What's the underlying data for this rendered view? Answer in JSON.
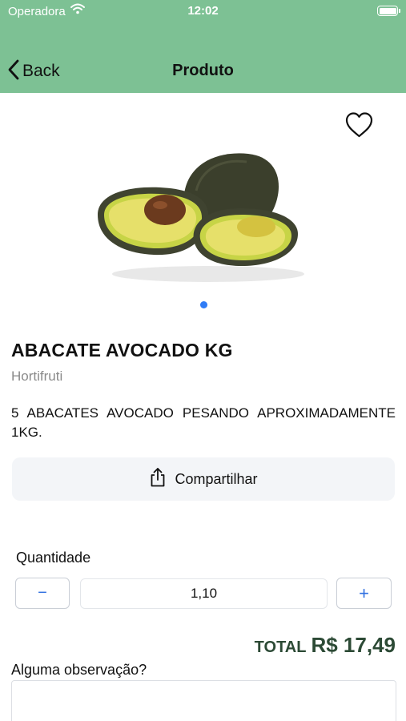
{
  "status_bar": {
    "carrier": "Operadora",
    "time": "12:02"
  },
  "nav": {
    "back_label": "Back",
    "title": "Produto"
  },
  "product": {
    "name": "ABACATE AVOCADO KG",
    "category": "Hortifruti",
    "description": "5 ABACATES AVOCADO PESANDO APROXIMADAMENTE 1KG.",
    "image_icon": "avocado-image",
    "favorite_icon": "heart-icon"
  },
  "share": {
    "label": "Compartilhar",
    "icon": "share-icon"
  },
  "quantity": {
    "label": "Quantidade",
    "value": "1,10",
    "minus_symbol": "−",
    "plus_symbol": "+"
  },
  "total": {
    "label": "TOTAL",
    "value": "R$ 17,49"
  },
  "observation": {
    "label": "Alguma observação?",
    "placeholder": ""
  },
  "colors": {
    "header_bg": "#7dc194",
    "accent_blue": "#2f7cf6",
    "total_text": "#2c4a35"
  }
}
